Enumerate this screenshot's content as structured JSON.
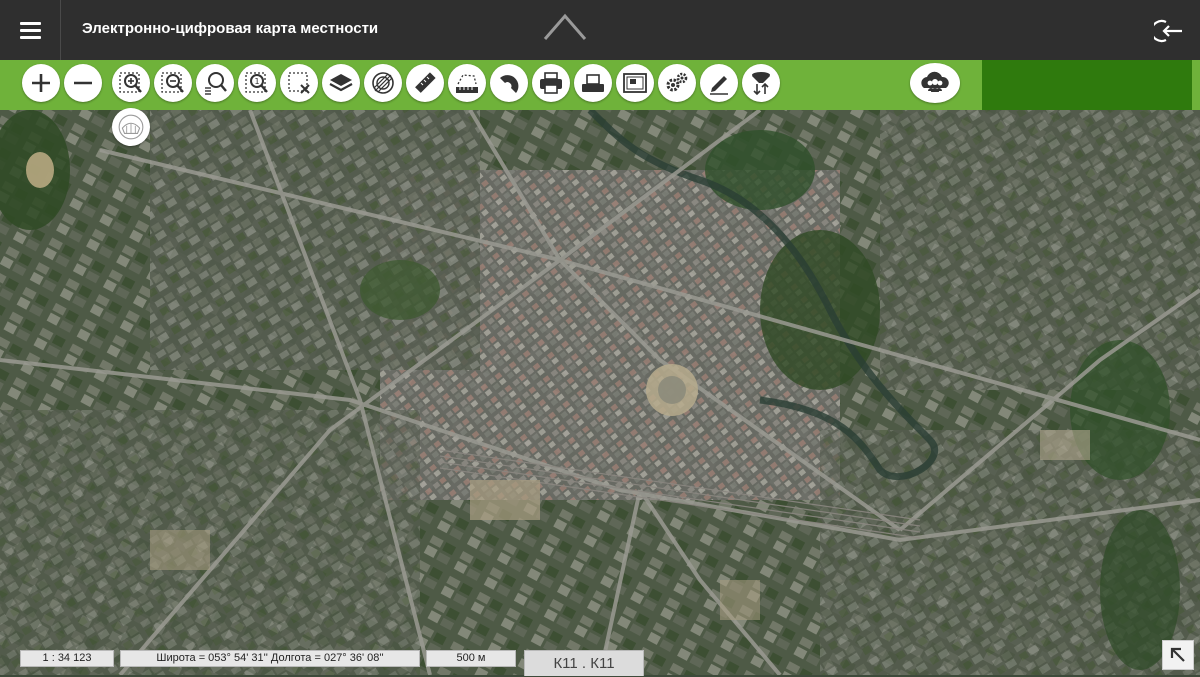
{
  "header": {
    "title": "Электронно-цифровая карта местности",
    "menu_icon": "hamburger-icon",
    "collapse_icon": "chevron-up-icon",
    "logout_icon": "logout-icon"
  },
  "toolbar": {
    "tools": [
      {
        "id": "zoom-in",
        "icon": "plus-icon"
      },
      {
        "id": "zoom-out",
        "icon": "minus-icon"
      },
      {
        "id": "zoom-in-area",
        "icon": "zoom-in-area-icon"
      },
      {
        "id": "zoom-out-area",
        "icon": "zoom-out-area-icon"
      },
      {
        "id": "search",
        "icon": "search-list-icon"
      },
      {
        "id": "zoom-full",
        "icon": "zoom-extent-icon"
      },
      {
        "id": "clear-selection",
        "icon": "clear-selection-icon"
      },
      {
        "id": "layers",
        "icon": "layers-icon"
      },
      {
        "id": "map-style",
        "icon": "circle-target-icon"
      },
      {
        "id": "measure-length",
        "icon": "ruler-icon"
      },
      {
        "id": "measure-area",
        "icon": "area-measure-icon"
      },
      {
        "id": "measure-angle",
        "icon": "protractor-icon"
      },
      {
        "id": "print",
        "icon": "printer-icon"
      },
      {
        "id": "print-preview",
        "icon": "print-preview-icon"
      },
      {
        "id": "map-view",
        "icon": "map-frame-icon"
      },
      {
        "id": "settings",
        "icon": "gears-icon"
      },
      {
        "id": "edit",
        "icon": "pencil-icon"
      },
      {
        "id": "filter",
        "icon": "filter-icon"
      },
      {
        "id": "users",
        "icon": "users-cloud-icon"
      }
    ],
    "colors": {
      "bar": "#6fb23a",
      "bar_dark": "#2f7a0d"
    }
  },
  "map": {
    "type": "satellite",
    "floating_tool_icon": "watermark-layer-icon"
  },
  "status": {
    "scale": "1 : 34 123",
    "coordinates": "Широта = 053° 54' 31'' Долгота = 027° 36' 08''",
    "scale_bar": "500 м",
    "sheet": "К11 . К11",
    "corner_icon": "arrow-up-left-icon"
  }
}
